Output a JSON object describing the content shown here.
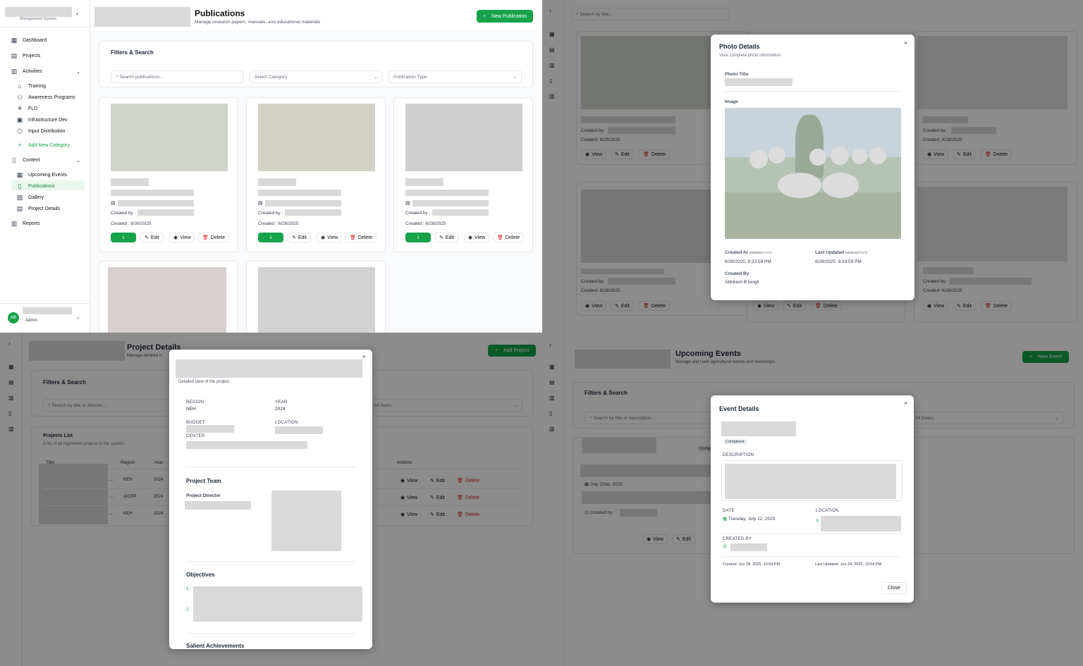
{
  "pubs": {
    "sidebar": {
      "subtitle": "Management System",
      "items": [
        "Dashboard",
        "Projects",
        "Activities"
      ],
      "activities": [
        "Training",
        "Awareness Programs",
        "FLD",
        "Infrastructure Dev",
        "Input Distribution"
      ],
      "add_category": "Add New Category",
      "content": "Content",
      "content_items": [
        "Upcoming Events",
        "Publications",
        "Gallery",
        "Project Details"
      ],
      "reports": "Reports",
      "user_initials": "AB",
      "user_role": "Admin"
    },
    "title": "Publications",
    "subtitle": "Manage research papers, manuals, and educational materials",
    "new_button": "New Publication",
    "filters_title": "Filters & Search",
    "search_placeholder": "Search publications...",
    "category_select": "Select Category",
    "type_select": "Publication Type",
    "created_by_label": "Created by :",
    "cards": [
      {
        "created": "Created : 6/30/2025"
      },
      {
        "created": "Created : 6/28/2025"
      },
      {
        "created": "Created : 6/28/2025"
      }
    ],
    "edit": "Edit",
    "view": "View",
    "delete": "Delete"
  },
  "gallery": {
    "search_placeholder": "Search by title...",
    "cards": [
      {
        "created_by": "Created by:",
        "created": "Created: 6/29/2025"
      },
      {
        "created_by": "Created by:",
        "created": "Created: 6/28/2025"
      },
      {
        "created_by": "Created by:",
        "created": "Created: 6/28/2025"
      },
      {
        "created_by": "Created by:",
        "created": "Created: 6/28/2025"
      }
    ],
    "modal": {
      "title": "Photo Details",
      "subtitle": "View complete photo information",
      "photo_title_label": "Photo Title",
      "image_label": "Image",
      "created_at_label": "Created At",
      "created_at_fmt": "(MM/DD/YYYY)",
      "created_at_value": "6/28/2025, 8:33:59 PM",
      "updated_label": "Last Updated",
      "updated_fmt": "(MM/DD/YYYY)",
      "updated_value": "6/28/2025, 8:33:59 PM",
      "created_by_label": "Created By",
      "created_by_value": "Abhilash B tengli"
    }
  },
  "projects": {
    "title": "Project Details",
    "subtitle": "Manage detailed in",
    "add_button": "Add Project",
    "filters_title": "Filters & Search",
    "search_placeholder": "Search by title or director...",
    "year_select": "All Years",
    "list_title": "Projects List",
    "list_subtitle": "A list of all registered projects in the system.",
    "columns": [
      "Title",
      "Region",
      "Year",
      "Actions"
    ],
    "rows": [
      {
        "region": "NEH",
        "year": "2024"
      },
      {
        "region": "AICRP",
        "year": "2024"
      },
      {
        "region": "NEH",
        "year": "2024"
      }
    ],
    "modal": {
      "subtitle": "Detailed view of the project.",
      "region_label": "REGION",
      "region_value": "NEH",
      "year_label": "YEAR",
      "year_value": "2024",
      "budget_label": "BUDGET",
      "location_label": "LOCATION",
      "center_label": "CENTER",
      "team_title": "Project Team",
      "director_label": "Project Director",
      "objectives_title": "Objectives",
      "obj_nums": [
        "1.",
        "2."
      ],
      "achievements_title": "Salient Achievements"
    }
  },
  "events": {
    "title": "Upcoming Events",
    "subtitle": "Manage and track agricultural events and workshops.",
    "new_button": "New Event",
    "filters_title": "Filters & Search",
    "search_placeholder": "Search by title or description...",
    "dates_select": "All Dates",
    "card_badge": "Compl",
    "card_date": "July 22nd, 2025",
    "card_created_by": "Created by :",
    "modal": {
      "title": "Event Details",
      "status": "Completed",
      "description_label": "DESCRIPTION",
      "date_label": "DATE",
      "date_value": "Tuesday, July 22, 2025",
      "location_label": "LOCATION",
      "created_by_label": "CREATED BY",
      "created": "Created: Jun 28, 2025, 10:04 PM",
      "updated": "Last Updated: Jun 28, 2025, 10:04 PM",
      "close": "Close"
    }
  }
}
